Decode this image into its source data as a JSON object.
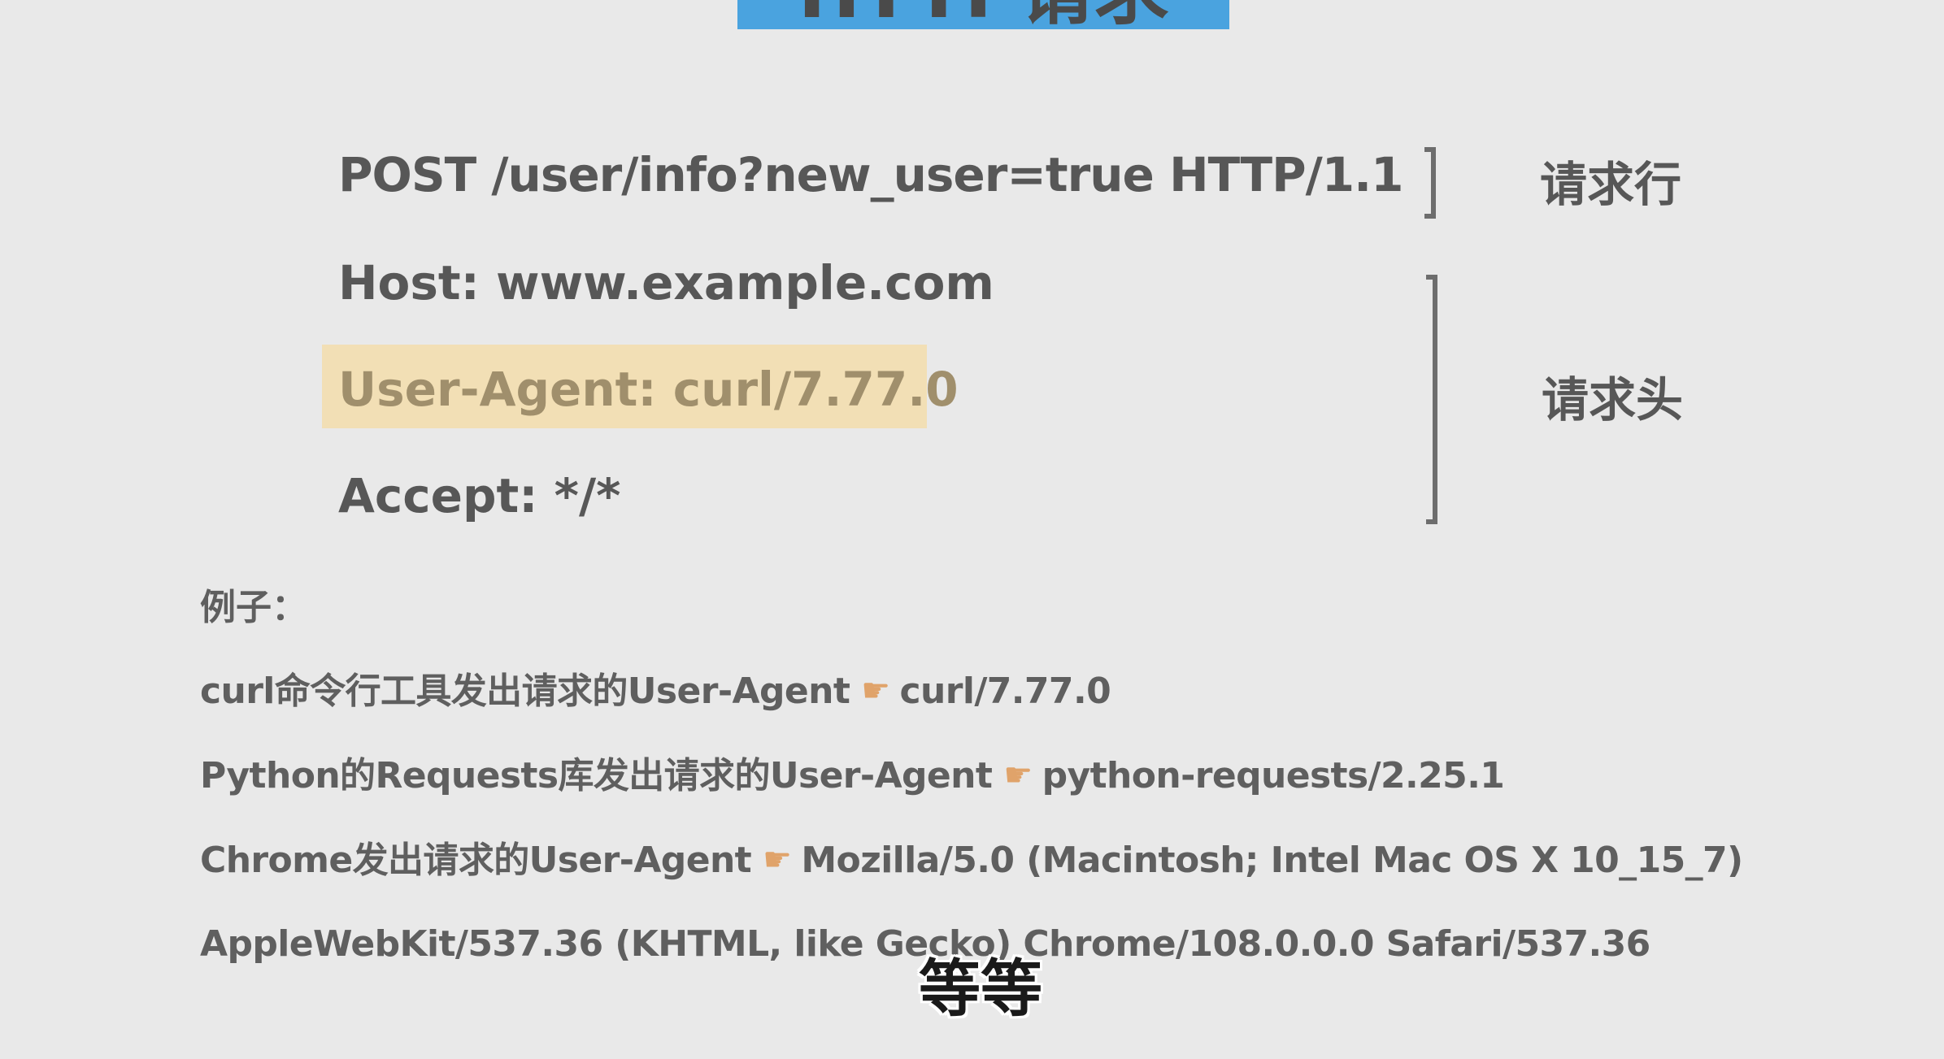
{
  "slide": {
    "title": "HTTP请求"
  },
  "request": {
    "request_line": "POST /user/info?new_user=true  HTTP/1.1",
    "host_line": "Host: www.example.com",
    "user_agent_line": "User-Agent: curl/7.77.0",
    "accept_line": "Accept: */*"
  },
  "labels": {
    "request_line_label": "请求行",
    "request_header_label": "请求头"
  },
  "examples": {
    "title": "例子：",
    "items": [
      {
        "prefix": "curl命令行工具发出请求的User-Agent",
        "value": "curl/7.77.0"
      },
      {
        "prefix": "Python的Requests库发出请求的User-Agent",
        "value": "python-requests/2.25.1"
      },
      {
        "prefix": "Chrome发出请求的User-Agent",
        "value": "Mozilla/5.0 (Macintosh; Intel Mac OS X 10_15_7)"
      }
    ],
    "continuation": "AppleWebKit/537.36 (KHTML, like Gecko) Chrome/108.0.0.0 Safari/537.36"
  },
  "subtitle": "等等",
  "icons": {
    "pointer": "pointing-hand-icon"
  },
  "colors": {
    "background": "#e9e9e9",
    "title_bar": "#4aa3df",
    "highlight": "#f2dfb5"
  }
}
